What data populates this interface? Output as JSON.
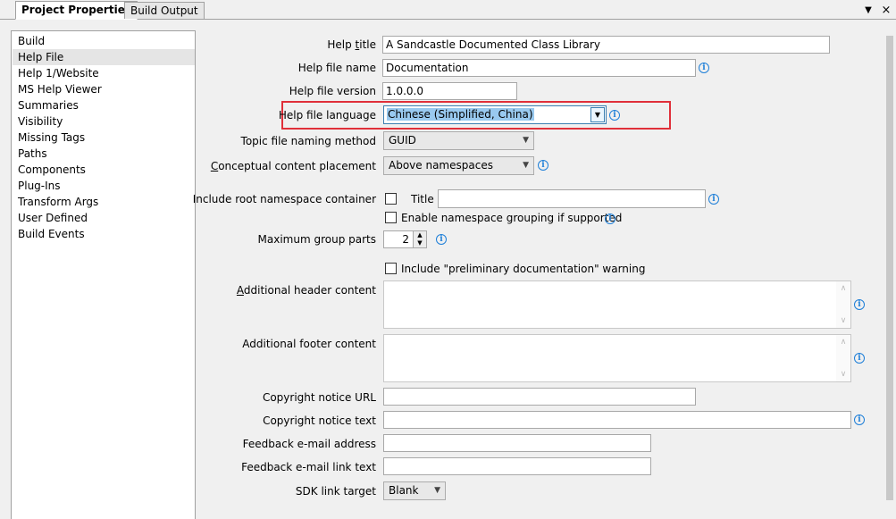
{
  "tabs": [
    {
      "label": "Project Properties",
      "active": true
    },
    {
      "label": "Build Output",
      "active": false
    }
  ],
  "nav": {
    "items": [
      "Build",
      "Help File",
      "Help 1/Website",
      "MS Help Viewer",
      "Summaries",
      "Visibility",
      "Missing Tags",
      "Paths",
      "Components",
      "Plug-Ins",
      "Transform Args",
      "User Defined",
      "Build Events"
    ],
    "selected": "Help File"
  },
  "form": {
    "help_title": {
      "label_pre": "Help ",
      "label_u": "t",
      "label_post": "itle",
      "value": "A Sandcastle Documented Class Library"
    },
    "help_file_name": {
      "label": "Help file name",
      "value": "Documentation"
    },
    "help_file_version": {
      "label": "Help file version",
      "value": "1.0.0.0"
    },
    "help_file_language": {
      "label": "Help file language",
      "value": "Chinese (Simplified, China)"
    },
    "topic_file_naming": {
      "label": "Topic file naming method",
      "value": "GUID"
    },
    "conceptual_placement": {
      "label_u": "C",
      "label_post": "onceptual content placement",
      "value": "Above namespaces"
    },
    "root_namespace": {
      "label": "Include root namespace container",
      "title_label": "Title",
      "title_value": ""
    },
    "namespace_grouping": {
      "label": "Enable namespace grouping if supported"
    },
    "max_group_parts": {
      "label": "Maximum group parts",
      "value": "2"
    },
    "preliminary": {
      "label": "Include \"preliminary documentation\" warning"
    },
    "header_content": {
      "label_u": "A",
      "label_post": "dditional header content",
      "value": ""
    },
    "footer_content": {
      "label": "Additional footer content",
      "value": ""
    },
    "copyright_url": {
      "label": "Copyright notice URL",
      "value": ""
    },
    "copyright_text": {
      "label": "Copyright notice text",
      "value": ""
    },
    "feedback_email": {
      "label": "Feedback e-mail address",
      "value": ""
    },
    "feedback_link_text": {
      "label": "Feedback e-mail link text",
      "value": ""
    },
    "sdk_link_target": {
      "label": "SDK link target",
      "value": "Blank"
    }
  },
  "icons": {
    "info": "info-icon",
    "dropdown": "chevron-down-icon",
    "close": "close-icon"
  },
  "colors": {
    "highlight_border": "#e0303a",
    "selection": "#99c9ef",
    "info_blue": "#1e7fd8"
  }
}
